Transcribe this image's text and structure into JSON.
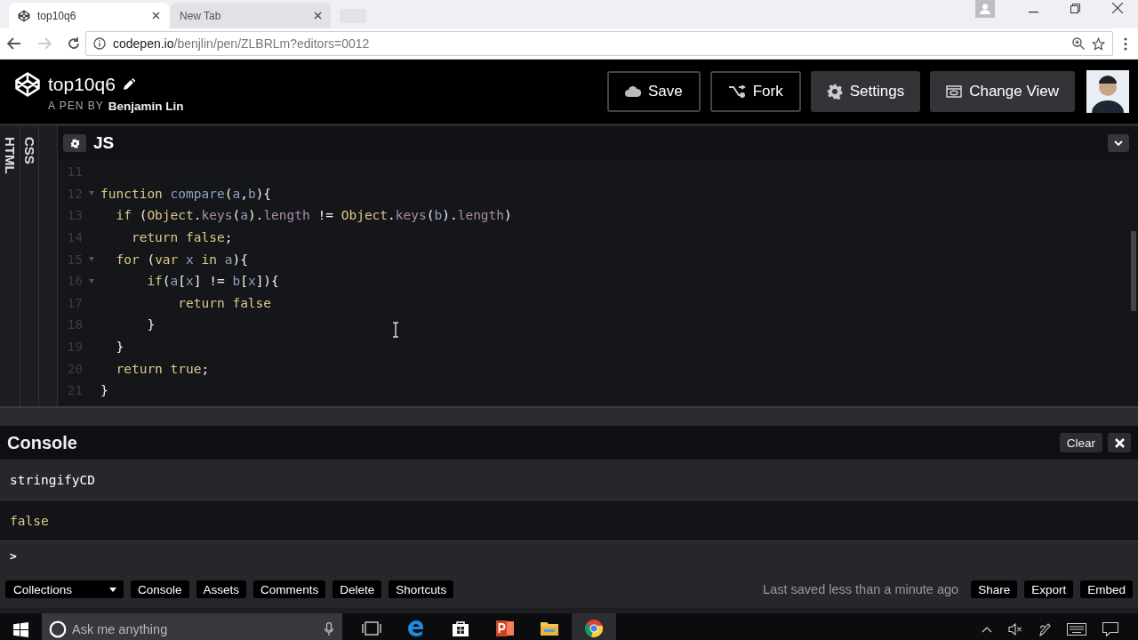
{
  "browser": {
    "tabs": [
      {
        "title": "top10q6",
        "selected": true
      },
      {
        "title": "New Tab",
        "selected": false
      }
    ],
    "url": {
      "host": "codepen.io",
      "path": "/benjlin/pen/ZLBRLm?editors=0012"
    }
  },
  "header": {
    "title": "top10q6",
    "byline_prefix": "A PEN BY",
    "author": "Benjamin Lin",
    "buttons": [
      {
        "label": "Save",
        "kind": "save"
      },
      {
        "label": "Fork",
        "kind": "fork"
      },
      {
        "label": "Settings",
        "kind": "settings"
      },
      {
        "label": "Change View",
        "kind": "view"
      }
    ]
  },
  "editor": {
    "side_tabs": [
      "HTML",
      "CSS"
    ],
    "panel_title": "JS",
    "lines": [
      {
        "number": "11",
        "fold": false
      },
      {
        "number": "12",
        "fold": true,
        "tokens": [
          {
            "text": "function ",
            "kind": "kw"
          },
          {
            "text": "compare",
            "kind": "id"
          },
          {
            "text": "(",
            "kind": "p"
          },
          {
            "text": "a",
            "kind": "id"
          },
          {
            "text": ",",
            "kind": "p"
          },
          {
            "text": "b",
            "kind": "id"
          },
          {
            "text": "){",
            "kind": "p"
          }
        ]
      },
      {
        "number": "13",
        "fold": false,
        "tokens": [
          {
            "text": "  if",
            "kind": "kw"
          },
          {
            "text": " (",
            "kind": "p"
          },
          {
            "text": "Object",
            "kind": "kw"
          },
          {
            "text": ".",
            "kind": "p"
          },
          {
            "text": "keys",
            "kind": "prop"
          },
          {
            "text": "(",
            "kind": "p"
          },
          {
            "text": "a",
            "kind": "id"
          },
          {
            "text": ").",
            "kind": "p"
          },
          {
            "text": "length",
            "kind": "prop"
          },
          {
            "text": " != ",
            "kind": "p"
          },
          {
            "text": "Object",
            "kind": "kw"
          },
          {
            "text": ".",
            "kind": "p"
          },
          {
            "text": "keys",
            "kind": "prop"
          },
          {
            "text": "(",
            "kind": "p"
          },
          {
            "text": "b",
            "kind": "id"
          },
          {
            "text": ").",
            "kind": "p"
          },
          {
            "text": "length",
            "kind": "prop"
          },
          {
            "text": ")",
            "kind": "p"
          }
        ]
      },
      {
        "number": "14",
        "fold": false,
        "tokens": [
          {
            "text": "    return false",
            "kind": "kw"
          },
          {
            "text": ";",
            "kind": "p"
          }
        ]
      },
      {
        "number": "15",
        "fold": true,
        "tokens": [
          {
            "text": "  for",
            "kind": "kw"
          },
          {
            "text": " (",
            "kind": "p"
          },
          {
            "text": "var",
            "kind": "kw"
          },
          {
            "text": " x ",
            "kind": "id"
          },
          {
            "text": "in",
            "kind": "kw"
          },
          {
            "text": " a",
            "kind": "id"
          },
          {
            "text": "){",
            "kind": "p"
          }
        ]
      },
      {
        "number": "16",
        "fold": true,
        "tokens": [
          {
            "text": "      if",
            "kind": "kw"
          },
          {
            "text": "(",
            "kind": "p"
          },
          {
            "text": "a",
            "kind": "id"
          },
          {
            "text": "[",
            "kind": "p"
          },
          {
            "text": "x",
            "kind": "id"
          },
          {
            "text": "] != ",
            "kind": "p"
          },
          {
            "text": "b",
            "kind": "id"
          },
          {
            "text": "[",
            "kind": "p"
          },
          {
            "text": "x",
            "kind": "id"
          },
          {
            "text": "]){",
            "kind": "p"
          }
        ]
      },
      {
        "number": "17",
        "fold": false,
        "tokens": [
          {
            "text": "          return false",
            "kind": "kw"
          }
        ]
      },
      {
        "number": "18",
        "fold": false,
        "tokens": [
          {
            "text": "      }",
            "kind": "p"
          }
        ]
      },
      {
        "number": "19",
        "fold": false,
        "tokens": [
          {
            "text": "  }",
            "kind": "p"
          }
        ]
      },
      {
        "number": "20",
        "fold": false,
        "tokens": [
          {
            "text": "  return true",
            "kind": "kw"
          },
          {
            "text": ";",
            "kind": "p"
          }
        ]
      },
      {
        "number": "21",
        "fold": false,
        "tokens": [
          {
            "text": "}",
            "kind": "p"
          }
        ]
      }
    ]
  },
  "console": {
    "title": "Console",
    "clear": "Clear",
    "entries": [
      {
        "text": "stringifyCD",
        "kind": "input"
      },
      {
        "text": "false",
        "kind": "output"
      }
    ],
    "prompt": ">"
  },
  "footer": {
    "collections": "Collections",
    "buttons": [
      "Console",
      "Assets",
      "Comments",
      "Delete",
      "Shortcuts"
    ],
    "status": "Last saved less than a minute ago",
    "right_buttons": [
      "Share",
      "Export",
      "Embed"
    ]
  },
  "taskbar": {
    "search": {
      "placeholder": "Ask me anything"
    },
    "apps": [
      {
        "kind": "taskview",
        "selected": false
      },
      {
        "kind": "edge",
        "selected": false
      },
      {
        "kind": "store",
        "selected": false
      },
      {
        "kind": "powerpoint",
        "selected": false
      },
      {
        "kind": "files",
        "selected": false
      },
      {
        "kind": "chrome",
        "selected": true
      }
    ]
  }
}
